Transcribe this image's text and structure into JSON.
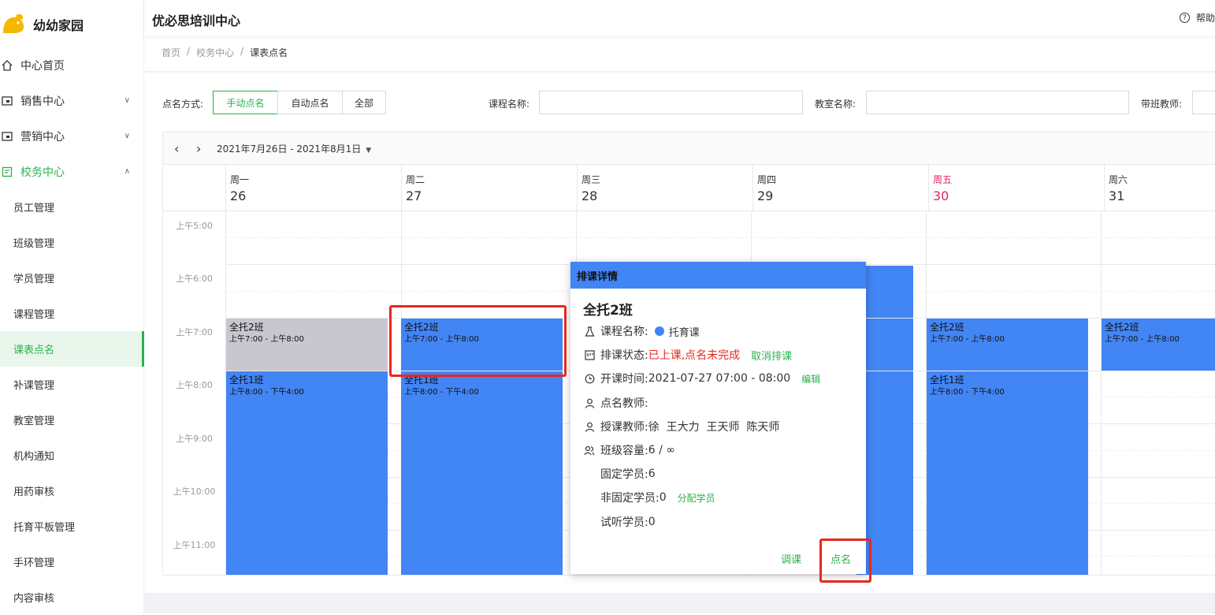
{
  "brand": {
    "name": "幼幼家园"
  },
  "header": {
    "org_title": "优必思培训中心",
    "help_label": "帮助"
  },
  "sidebar": {
    "menus": [
      {
        "label": "中心首页"
      },
      {
        "label": "销售中心"
      },
      {
        "label": "营销中心"
      },
      {
        "label": "校务中心"
      }
    ],
    "sub_items": [
      {
        "label": "员工管理"
      },
      {
        "label": "班级管理"
      },
      {
        "label": "学员管理"
      },
      {
        "label": "课程管理"
      },
      {
        "label": "课表点名"
      },
      {
        "label": "补课管理"
      },
      {
        "label": "教室管理"
      },
      {
        "label": "机构通知"
      },
      {
        "label": "用药审核"
      },
      {
        "label": "托育平板管理"
      },
      {
        "label": "手环管理"
      },
      {
        "label": "内容审核"
      }
    ]
  },
  "breadcrumb": {
    "home": "首页",
    "sep": "/",
    "section": "校务中心",
    "current": "课表点名"
  },
  "filters": {
    "mode_label": "点名方式:",
    "modes": [
      "手动点名",
      "自动点名",
      "全部"
    ],
    "course_label": "课程名称:",
    "room_label": "教室名称:",
    "teacher_label": "带班教师:"
  },
  "calendar": {
    "range": "2021年7月26日 - 2021年8月1日",
    "days": [
      {
        "name": "周一",
        "num": "26"
      },
      {
        "name": "周二",
        "num": "27"
      },
      {
        "name": "周三",
        "num": "28"
      },
      {
        "name": "周四",
        "num": "29"
      },
      {
        "name": "周五",
        "num": "30"
      },
      {
        "name": "周六",
        "num": "31"
      }
    ],
    "times": [
      "上午5:00",
      "上午6:00",
      "上午7:00",
      "上午8:00",
      "上午9:00",
      "上午10:00",
      "上午11:00"
    ],
    "events": [
      {
        "title": "全托2班",
        "time": "上午7:00 - 上午8:00"
      },
      {
        "title": "全托1班",
        "time": "上午8:00 - 下午4:00"
      }
    ]
  },
  "popup": {
    "header": "排课详情",
    "class_name": "全托2班",
    "course_label": "课程名称:",
    "course_value": "托育课",
    "status_label": "排课状态:",
    "status_value": "已上课,点名未完成",
    "cancel_link": "取消排课",
    "time_label": "开课时间:",
    "time_value": "2021-07-27 07:00 - 08:00",
    "edit_link": "编辑",
    "roll_teacher_label": "点名教师:",
    "teach_label": "授课教师:",
    "teach_value": "徐  王大力  王天师  陈天师",
    "capacity_label": "班级容量:",
    "capacity_value": "6 / ∞",
    "fixed_label": "固定学员:",
    "fixed_value": "6",
    "nonfixed_label": "非固定学员:",
    "nonfixed_value": "0",
    "assign_link": "分配学员",
    "trial_label": "试听学员:",
    "trial_value": "0",
    "adjust_btn": "调课",
    "rollcall_btn": "点名"
  },
  "colors": {
    "accent": "#2bb24c",
    "event": "#4285f4",
    "event_done": "#c8c6ce",
    "highlight": "#e8281e",
    "today": "#e0245e"
  }
}
